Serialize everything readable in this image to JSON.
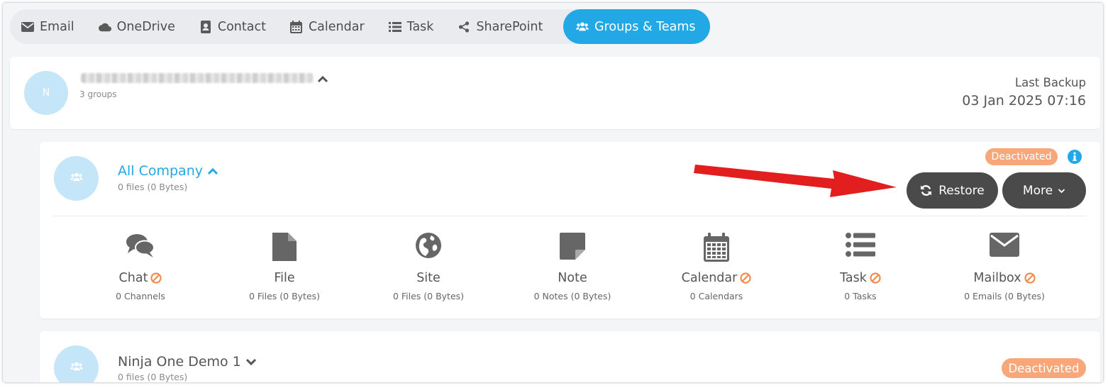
{
  "tabs": [
    {
      "label": "Email",
      "icon": "envelope-icon"
    },
    {
      "label": "OneDrive",
      "icon": "cloud-icon"
    },
    {
      "label": "Contact",
      "icon": "contact-card-icon"
    },
    {
      "label": "Calendar",
      "icon": "calendar-icon"
    },
    {
      "label": "Task",
      "icon": "list-icon"
    },
    {
      "label": "SharePoint",
      "icon": "share-icon"
    },
    {
      "label": "Groups & Teams",
      "icon": "users-icon",
      "active": true
    }
  ],
  "account": {
    "avatar_initial": "N",
    "subtitle": "3 groups",
    "last_backup_label": "Last Backup",
    "last_backup_value": "03 Jan 2025 07:16"
  },
  "groups": [
    {
      "name": "All Company",
      "summary": "0 files (0 Bytes)",
      "status": "Deactivated",
      "expanded": true,
      "actions": {
        "restore": "Restore",
        "more": "More"
      },
      "features": [
        {
          "label": "Chat",
          "count": "0 Channels",
          "icon": "chat-icon",
          "disabled": true
        },
        {
          "label": "File",
          "count": "0 Files (0 Bytes)",
          "icon": "file-icon",
          "disabled": false
        },
        {
          "label": "Site",
          "count": "0 Files (0 Bytes)",
          "icon": "globe-icon",
          "disabled": false
        },
        {
          "label": "Note",
          "count": "0 Notes (0 Bytes)",
          "icon": "note-icon",
          "disabled": false
        },
        {
          "label": "Calendar",
          "count": "0 Calendars",
          "icon": "calendar-icon",
          "disabled": true
        },
        {
          "label": "Task",
          "count": "0 Tasks",
          "icon": "list-icon",
          "disabled": true
        },
        {
          "label": "Mailbox",
          "count": "0 Emails (0 Bytes)",
          "icon": "envelope-icon",
          "disabled": true
        }
      ]
    },
    {
      "name": "Ninja One Demo 1",
      "summary": "0 files (0 Bytes)",
      "status": "Deactivated",
      "expanded": false
    }
  ],
  "colors": {
    "accent": "#23a8e6",
    "badge": "#f7a77a",
    "button_dark": "#4a4a4a",
    "avatar": "#c5e6f8",
    "disabled_sign": "#f28b4e",
    "annotation_arrow": "#e31e1e"
  }
}
